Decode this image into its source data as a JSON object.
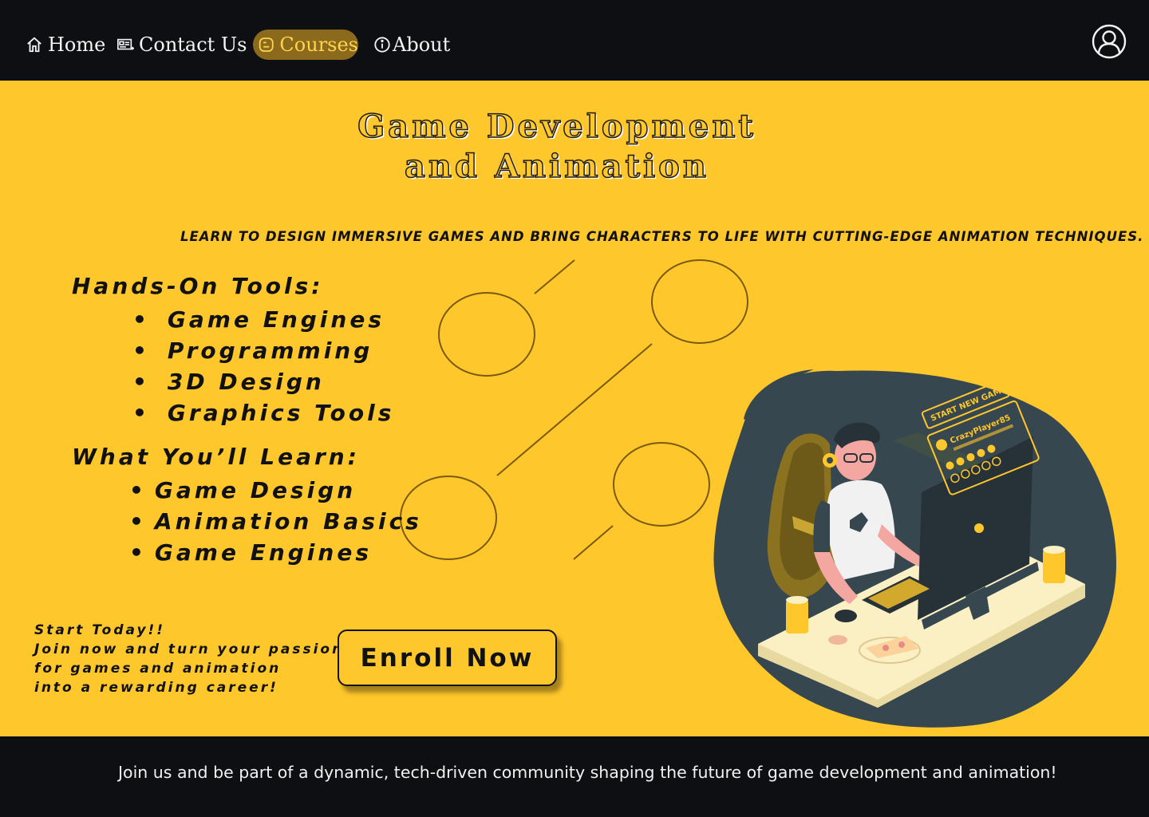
{
  "nav": {
    "home": "Home",
    "contact": "Contact Us",
    "courses": "Courses",
    "about": "About",
    "active": "Courses"
  },
  "hero": {
    "title_line1": "Game Development",
    "title_line2": "and Animation",
    "tagline": "LEARN TO DESIGN IMMERSIVE GAMES AND BRING CHARACTERS TO LIFE WITH CUTTING-EDGE ANIMATION TECHNIQUES.",
    "tools_heading": "Hands-On Tools:",
    "tools": [
      "Game Engines",
      "Programming",
      "3D Design",
      "Graphics Tools"
    ],
    "learn_heading": "What You’ll Learn:",
    "learn": [
      "Game Design",
      "Animation Basics",
      "Game Engines"
    ],
    "cta_lines": [
      "Start Today!!",
      "Join now and turn your passion",
      "for games and animation",
      "into a rewarding career!"
    ],
    "enroll_label": "Enroll Now",
    "illustration": {
      "start_new_game": "START NEW GAME",
      "player_name": "CrazyPlayer85"
    }
  },
  "footer": {
    "text": "Join us and be part of a dynamic, tech-driven community shaping the future of game development and animation!"
  },
  "colors": {
    "accent": "#fec72b",
    "dark": "#0e0f12",
    "active_tab": "#8b6a1d",
    "illustration_blob": "#37474f"
  },
  "icons": [
    "home-icon",
    "contact-card-icon",
    "blog-icon",
    "info-icon",
    "user-profile-icon"
  ]
}
